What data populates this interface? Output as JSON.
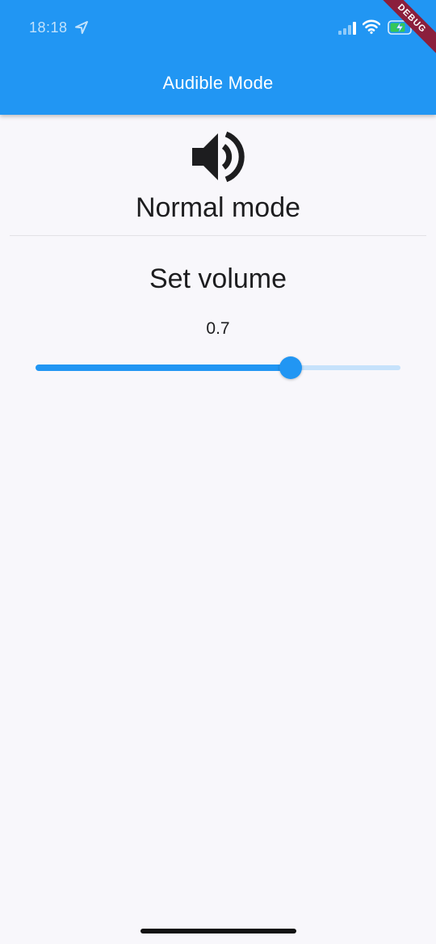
{
  "status_bar": {
    "time": "18:18",
    "location_icon": "location-arrow-icon",
    "signal_icon": "cellular-signal-icon",
    "wifi_icon": "wifi-icon",
    "battery_icon": "battery-charging-icon"
  },
  "debug_banner": "DEBUG",
  "app_bar": {
    "title": "Audible Mode",
    "color": "#2196f3"
  },
  "mode": {
    "icon": "volume-up-icon",
    "label": "Normal mode"
  },
  "volume_section": {
    "title": "Set volume",
    "value_text": "0.7",
    "value": 0.7,
    "active_color": "#2196f3",
    "inactive_color": "#c6e2fb"
  }
}
